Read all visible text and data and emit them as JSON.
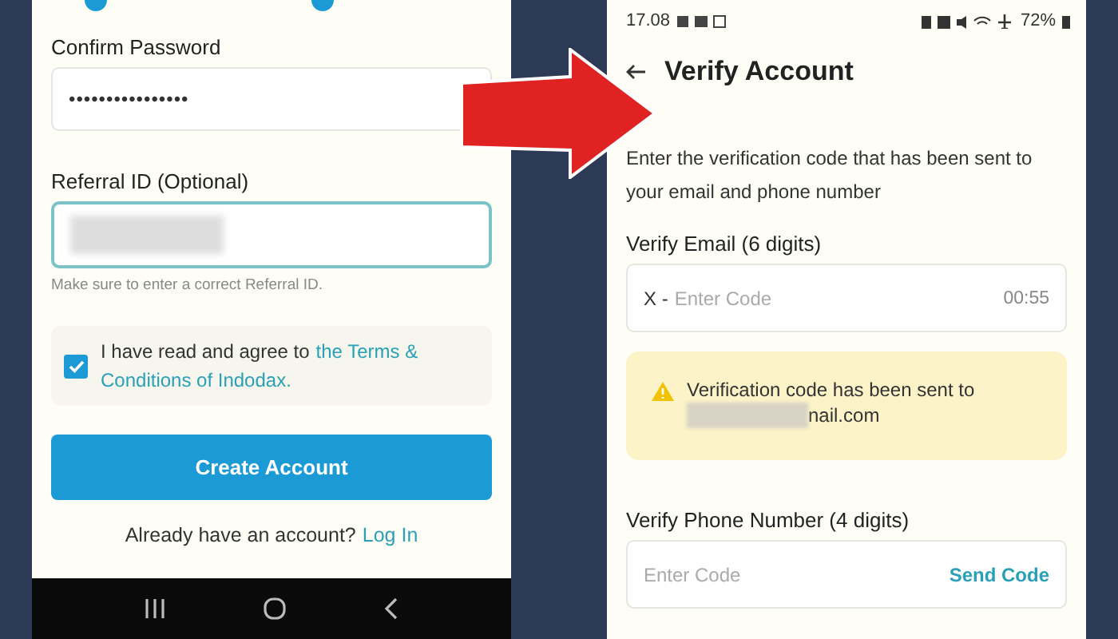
{
  "signup_screen": {
    "confirm_password": {
      "label": "Confirm Password",
      "value": "••••••••••••••••"
    },
    "referral": {
      "label": "Referral ID (Optional)",
      "hint": "Make sure to enter a correct Referral ID."
    },
    "terms": {
      "checked": true,
      "text": "I have read and agree to",
      "link_lines": [
        "the Terms &",
        "Conditions of Indodax."
      ]
    },
    "create_button": "Create Account",
    "login_prompt": "Already have an account?",
    "login_link": "Log In"
  },
  "verify_screen": {
    "status_bar": {
      "time": "17.08",
      "battery": "72%"
    },
    "title": "Verify Account",
    "intro": "Enter the verification code that has been sent to your email and phone number",
    "email": {
      "label": "Verify Email (6 digits)",
      "prefix": "X -",
      "placeholder": "Enter Code",
      "timer": "00:55"
    },
    "alert": {
      "text": "Verification code has been sent to",
      "email_end": "nail.com"
    },
    "phone": {
      "label": "Verify Phone Number (4 digits)",
      "placeholder": "Enter Code",
      "action": "Send Code"
    }
  }
}
